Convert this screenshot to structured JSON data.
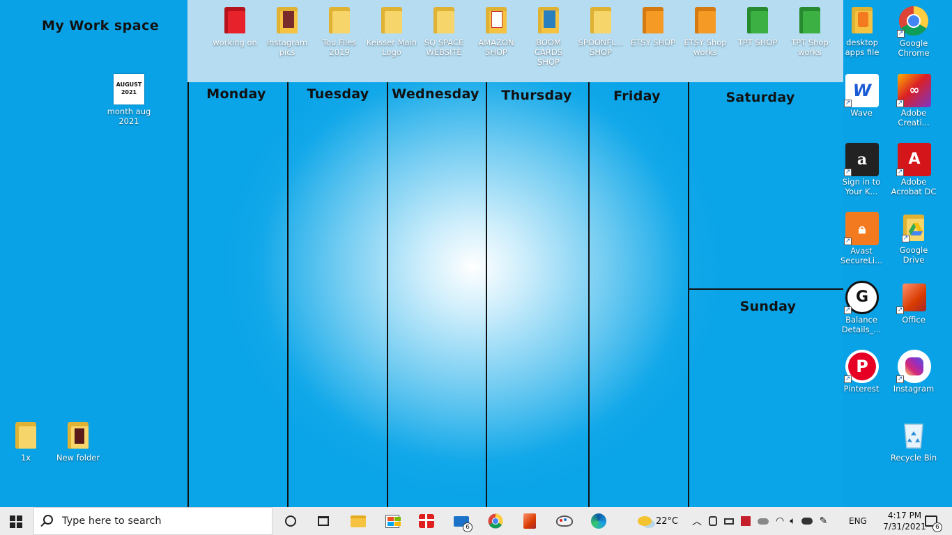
{
  "desktop": {
    "workspace_title": "My Work space",
    "days": [
      "Monday",
      "Tuesday",
      "Wednesday",
      "Thursday",
      "Friday",
      "Saturday",
      "Sunday"
    ],
    "top_icons": [
      {
        "label": "working on",
        "kind": "folder",
        "color": "#e8222a"
      },
      {
        "label": "instagram pics",
        "kind": "folder-photo",
        "color": "#f5c242"
      },
      {
        "label": "Tou Files 2019",
        "kind": "folder",
        "color": "#f6d56a"
      },
      {
        "label": "Keisser Main Logo",
        "kind": "folder",
        "color": "#f6d56a"
      },
      {
        "label": "SQ SPACE WEBSITE",
        "kind": "folder",
        "color": "#f6d56a"
      },
      {
        "label": "AMAZON SHOP",
        "kind": "folder-pdf",
        "color": "#f5c242"
      },
      {
        "label": "BOOM CARDS SHOP",
        "kind": "folder-photo",
        "color": "#f5c242"
      },
      {
        "label": "SPOONFL... SHOP",
        "kind": "folder",
        "color": "#f6d56a"
      },
      {
        "label": "ETSY SHOP",
        "kind": "folder",
        "color": "#f59a25"
      },
      {
        "label": "ETSY Shop works",
        "kind": "folder",
        "color": "#f59a25"
      },
      {
        "label": "TPT SHOP",
        "kind": "folder",
        "color": "#3cb043"
      },
      {
        "label": "TPT Shop works",
        "kind": "folder",
        "color": "#3cb043"
      },
      {
        "label": "desktop apps file",
        "kind": "folder-photo",
        "color": "#f5c242"
      },
      {
        "label": "Google Chrome",
        "kind": "chrome",
        "color": "#4285f4"
      }
    ],
    "right_icons": [
      {
        "label": "Wave",
        "icon": "wave-icon",
        "color": "#ffffff"
      },
      {
        "label": "Adobe Creati...",
        "icon": "adobe-cc-icon",
        "color": "#da1f26"
      },
      {
        "label": "Sign in to Your K...",
        "icon": "amazon-icon",
        "color": "#222222"
      },
      {
        "label": "Adobe Acrobat DC",
        "icon": "acrobat-icon",
        "color": "#b30b00"
      },
      {
        "label": "Avast SecureLi...",
        "icon": "avast-icon",
        "color": "#f47a20"
      },
      {
        "label": "Google Drive",
        "icon": "google-drive-icon",
        "color": "#f6d56a"
      },
      {
        "label": "Balance Details_...",
        "icon": "balance-icon",
        "color": "#ffffff"
      },
      {
        "label": "Office",
        "icon": "office-icon",
        "color": "#d83b01"
      },
      {
        "label": "Pinterest",
        "icon": "pinterest-icon",
        "color": "#e60023"
      },
      {
        "label": "Instagram",
        "icon": "instagram-icon",
        "color": "#c13584"
      },
      {
        "label": "Recycle Bin",
        "icon": "recycle-bin-icon",
        "color": "#d9eef9"
      }
    ],
    "left_icons": [
      {
        "label": "month aug 2021",
        "thumb_line1": "AUGUST",
        "thumb_line2": "2021"
      },
      {
        "label": "1x"
      },
      {
        "label": "New folder"
      }
    ]
  },
  "taskbar": {
    "search_placeholder": "Type here to search",
    "mail_badge": "6",
    "weather": "22°C",
    "language": "ENG",
    "time": "4:17 PM",
    "date": "7/31/2021",
    "notification_count": "6",
    "colors": {
      "taskbar_bg": "#ececec",
      "desktop_blue": "#0aa3e6"
    }
  }
}
